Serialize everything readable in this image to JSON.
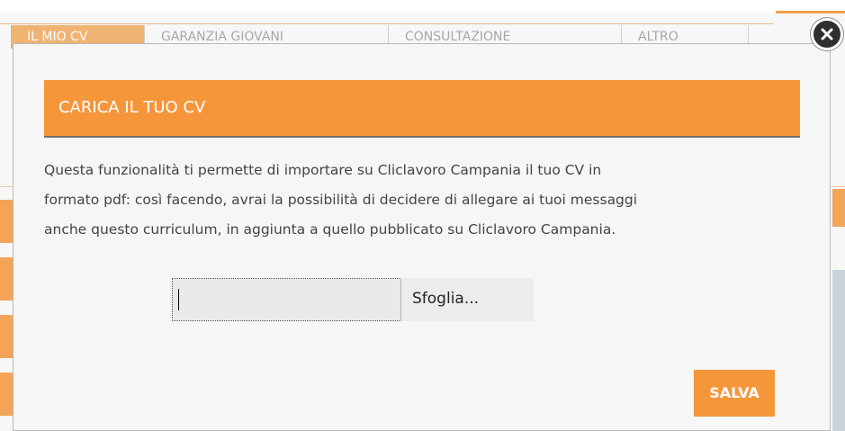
{
  "background": {
    "tabs": [
      {
        "label": "IL MIO CV"
      },
      {
        "label": "GARANZIA GIOVANI"
      },
      {
        "label": "CONSULTAZIONE"
      },
      {
        "label": "ALTRO"
      }
    ]
  },
  "dialog": {
    "title": "CARICA IL TUO CV",
    "body_line_1": "Questa funzionalità ti permette di importare su Cliclavoro Campania il tuo CV in",
    "body_line_2": "formato pdf: così facendo, avrai la possibilità di decidere di allegare ai tuoi messaggi",
    "body_line_3": "anche questo curriculum, in aggiunta a quello pubblicato su Cliclavoro Campania.",
    "file_input": {
      "value": "",
      "browse_label": "Sfoglia..."
    },
    "save_label": "SALVA"
  },
  "colors": {
    "accent": "#f5963a",
    "close_button": "#2f2f2f"
  },
  "icons": {
    "close": "close-icon"
  }
}
